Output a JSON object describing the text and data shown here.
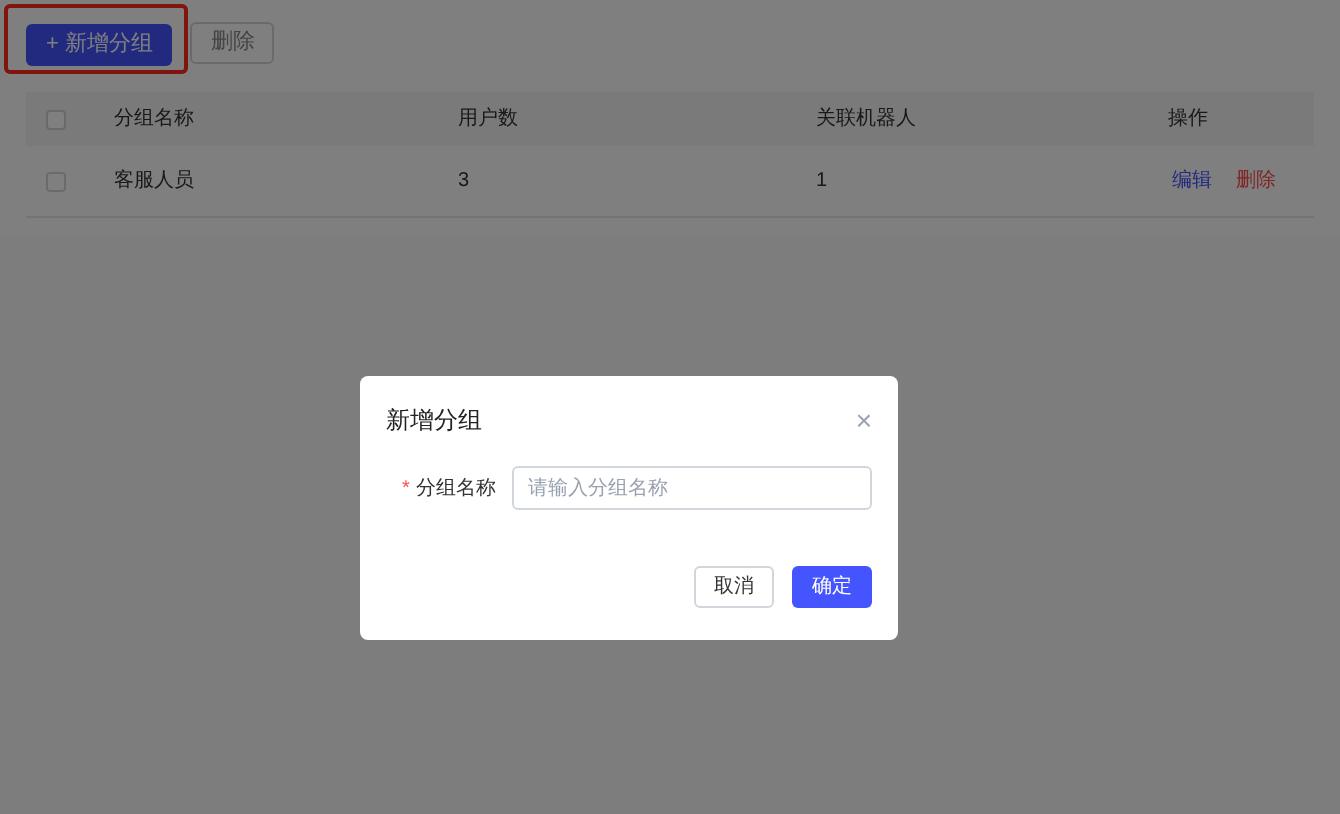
{
  "toolbar": {
    "add_button": "+ 新增分组",
    "delete_button": {
      "label": "删除",
      "disabled": true
    }
  },
  "table": {
    "header_checked": false,
    "columns": [
      "分组名称",
      "用户数",
      "关联机器人",
      "操作"
    ],
    "rows": [
      {
        "checked": false,
        "cells": [
          "客服人员",
          "3",
          "1"
        ],
        "actions": [
          {
            "label": "编辑",
            "kind": "edit"
          },
          {
            "label": "删除",
            "kind": "delete"
          }
        ]
      }
    ]
  },
  "dialog": {
    "title": "新增分组",
    "close": "×",
    "field": {
      "label": "分组名称",
      "required_mark": "*",
      "placeholder": "请输入分组名称"
    },
    "buttons": [
      {
        "label": "取消",
        "kind": "secondary"
      },
      {
        "label": "确定",
        "kind": "primary"
      }
    ]
  }
}
